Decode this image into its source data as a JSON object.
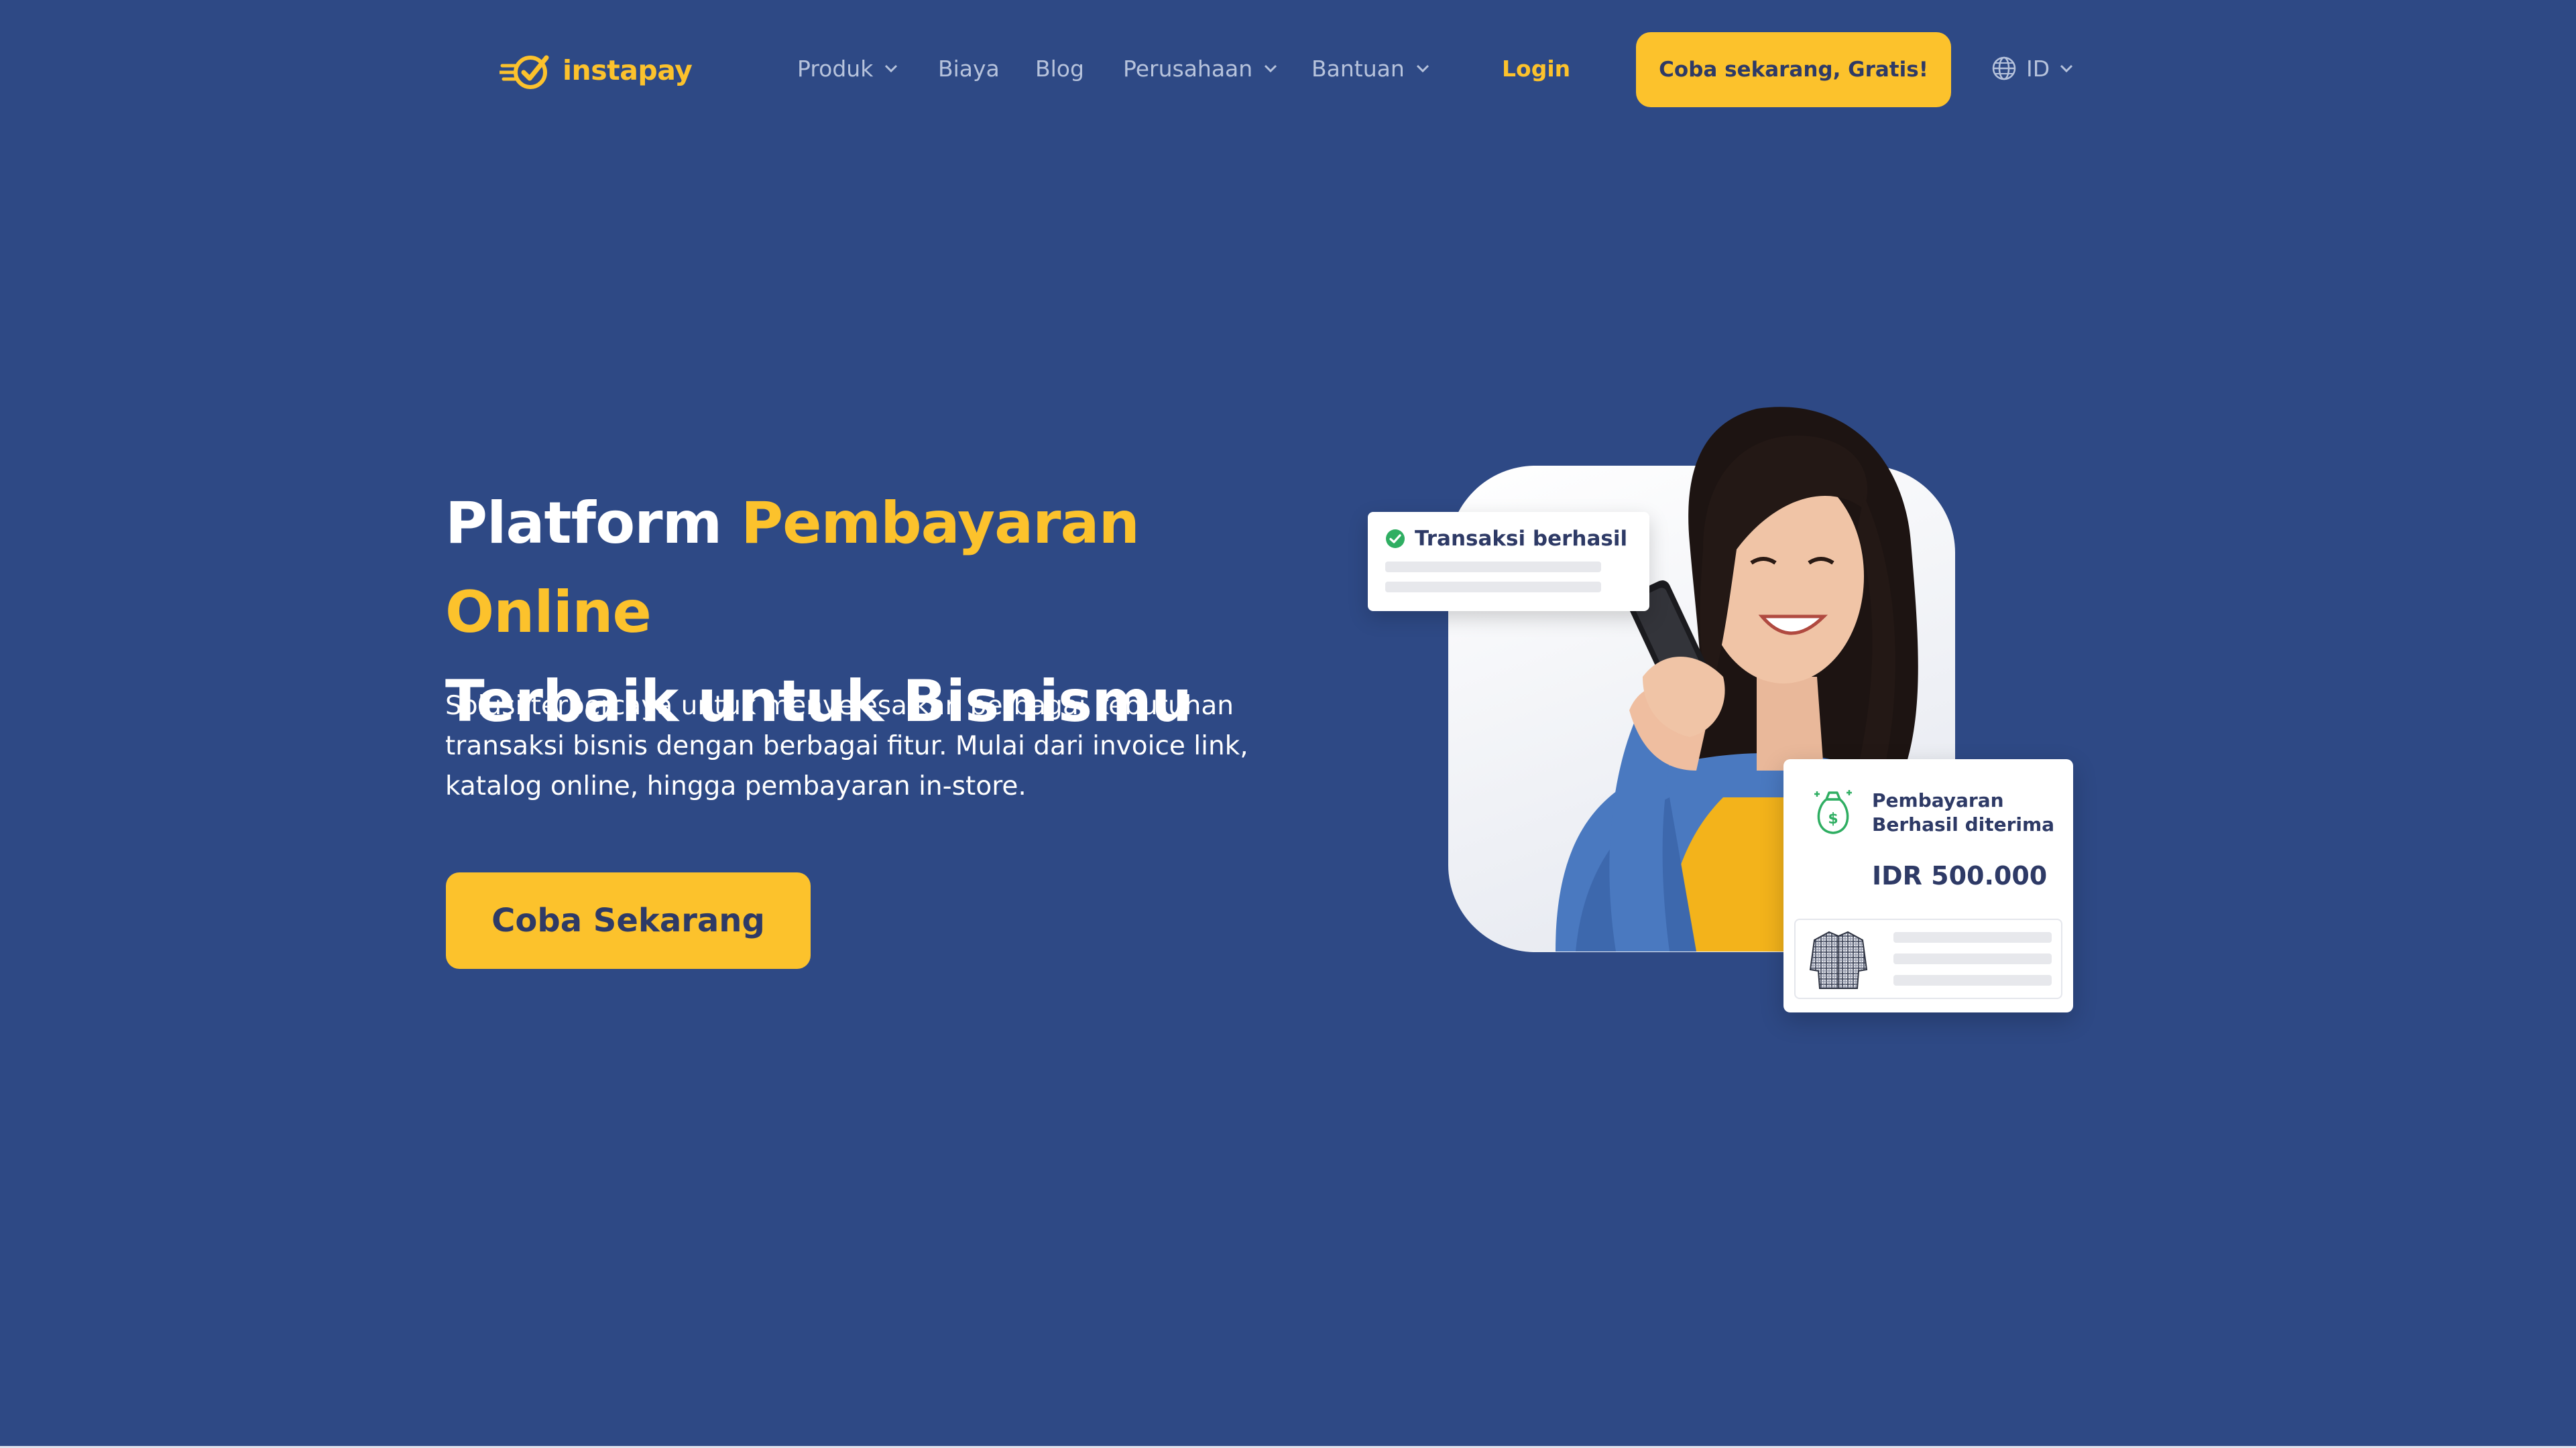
{
  "brand": {
    "name": "instapay",
    "accent": "#fcc22c",
    "background": "#2e4985",
    "dark_text": "#2e3a66"
  },
  "nav": {
    "items": [
      {
        "label": "Produk",
        "dropdown": true
      },
      {
        "label": "Biaya",
        "dropdown": false
      },
      {
        "label": "Blog",
        "dropdown": false
      },
      {
        "label": "Perusahaan",
        "dropdown": true
      },
      {
        "label": "Bantuan",
        "dropdown": true
      }
    ],
    "login_label": "Login",
    "cta_label": "Coba sekarang, Gratis!",
    "language": "ID",
    "language_icon": "globe-icon"
  },
  "hero": {
    "title_part1": "Platform ",
    "title_accent": "Pembayaran Online",
    "title_part2": "Terbaik untuk Bisnismu",
    "subtitle": "Solusi terpercaya untuk menyelesaikan berbagai kebutuhan transaksi bisnis dengan berbagai fitur. Mulai dari invoice link, katalog online, hingga pembayaran in-store.",
    "cta_label": "Coba Sekarang"
  },
  "illustration": {
    "transaction_card": {
      "title": "Transaksi berhasil",
      "icon": "check-circle-icon"
    },
    "payment_card": {
      "title": "Pembayaran Berhasil diterima",
      "amount": "IDR 500.000",
      "icon": "money-bag-icon",
      "product_icon": "shirt-icon"
    }
  }
}
